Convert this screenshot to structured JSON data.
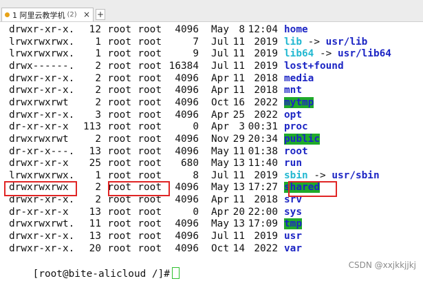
{
  "tab": {
    "title": "1 阿里云教学机",
    "count": "(2)",
    "close": "×",
    "new": "+"
  },
  "rows": [
    {
      "perm": "drwxr-xr-x.",
      "links": "12",
      "owner": "root",
      "group": "root",
      "size": "4096",
      "mon": "May",
      "day": "8",
      "time": "12:04",
      "name": "home",
      "type": "dir"
    },
    {
      "perm": "lrwxrwxrwx.",
      "links": "1",
      "owner": "root",
      "group": "root",
      "size": "7",
      "mon": "Jul",
      "day": "11",
      "time": "2019",
      "name": "lib",
      "type": "link",
      "target": "usr/lib"
    },
    {
      "perm": "lrwxrwxrwx.",
      "links": "1",
      "owner": "root",
      "group": "root",
      "size": "9",
      "mon": "Jul",
      "day": "11",
      "time": "2019",
      "name": "lib64",
      "type": "link",
      "target": "usr/lib64"
    },
    {
      "perm": "drwx------.",
      "links": "2",
      "owner": "root",
      "group": "root",
      "size": "16384",
      "mon": "Jul",
      "day": "11",
      "time": "2019",
      "name": "lost+found",
      "type": "dir"
    },
    {
      "perm": "drwxr-xr-x.",
      "links": "2",
      "owner": "root",
      "group": "root",
      "size": "4096",
      "mon": "Apr",
      "day": "11",
      "time": "2018",
      "name": "media",
      "type": "dir"
    },
    {
      "perm": "drwxr-xr-x.",
      "links": "2",
      "owner": "root",
      "group": "root",
      "size": "4096",
      "mon": "Apr",
      "day": "11",
      "time": "2018",
      "name": "mnt",
      "type": "dir"
    },
    {
      "perm": "drwxrwxrwt",
      "links": "2",
      "owner": "root",
      "group": "root",
      "size": "4096",
      "mon": "Oct",
      "day": "16",
      "time": "2022",
      "name": "mytmp",
      "type": "hl"
    },
    {
      "perm": "drwxr-xr-x.",
      "links": "3",
      "owner": "root",
      "group": "root",
      "size": "4096",
      "mon": "Apr",
      "day": "25",
      "time": "2022",
      "name": "opt",
      "type": "dir"
    },
    {
      "perm": "dr-xr-xr-x",
      "links": "113",
      "owner": "root",
      "group": "root",
      "size": "0",
      "mon": "Apr",
      "day": "3",
      "time": "00:31",
      "name": "proc",
      "type": "dir"
    },
    {
      "perm": "drwxrwxrwt",
      "links": "2",
      "owner": "root",
      "group": "root",
      "size": "4096",
      "mon": "Nov",
      "day": "29",
      "time": "20:34",
      "name": "public",
      "type": "hl"
    },
    {
      "perm": "dr-xr-x---.",
      "links": "13",
      "owner": "root",
      "group": "root",
      "size": "4096",
      "mon": "May",
      "day": "11",
      "time": "01:38",
      "name": "root",
      "type": "dir"
    },
    {
      "perm": "drwxr-xr-x",
      "links": "25",
      "owner": "root",
      "group": "root",
      "size": "680",
      "mon": "May",
      "day": "13",
      "time": "11:40",
      "name": "run",
      "type": "dir"
    },
    {
      "perm": "lrwxrwxrwx.",
      "links": "1",
      "owner": "root",
      "group": "root",
      "size": "8",
      "mon": "Jul",
      "day": "11",
      "time": "2019",
      "name": "sbin",
      "type": "link",
      "target": "usr/sbin"
    },
    {
      "perm": "drwxrwxrwx",
      "links": "2",
      "owner": "root",
      "group": "root",
      "size": "4096",
      "mon": "May",
      "day": "13",
      "time": "17:27",
      "name": "shared",
      "type": "hl"
    },
    {
      "perm": "drwxr-xr-x.",
      "links": "2",
      "owner": "root",
      "group": "root",
      "size": "4096",
      "mon": "Apr",
      "day": "11",
      "time": "2018",
      "name": "srv",
      "type": "dir"
    },
    {
      "perm": "dr-xr-xr-x",
      "links": "13",
      "owner": "root",
      "group": "root",
      "size": "0",
      "mon": "Apr",
      "day": "20",
      "time": "22:00",
      "name": "sys",
      "type": "dir"
    },
    {
      "perm": "drwxrwxrwt.",
      "links": "11",
      "owner": "root",
      "group": "root",
      "size": "4096",
      "mon": "May",
      "day": "13",
      "time": "17:09",
      "name": "tmp",
      "type": "hl"
    },
    {
      "perm": "drwxr-xr-x.",
      "links": "13",
      "owner": "root",
      "group": "root",
      "size": "4096",
      "mon": "Jul",
      "day": "11",
      "time": "2019",
      "name": "usr",
      "type": "dir"
    },
    {
      "perm": "drwxr-xr-x.",
      "links": "20",
      "owner": "root",
      "group": "root",
      "size": "4096",
      "mon": "Oct",
      "day": "14",
      "time": "2022",
      "name": "var",
      "type": "dir"
    }
  ],
  "prompt": "[root@bite-alicloud /]#",
  "link_arrow": "->",
  "watermark": "CSDN @xxjkkjjkj",
  "colors": {
    "dir": "#1c25c4",
    "link": "#22b8d1",
    "highlight": "#1faa2a",
    "annotation": "#e02424"
  }
}
